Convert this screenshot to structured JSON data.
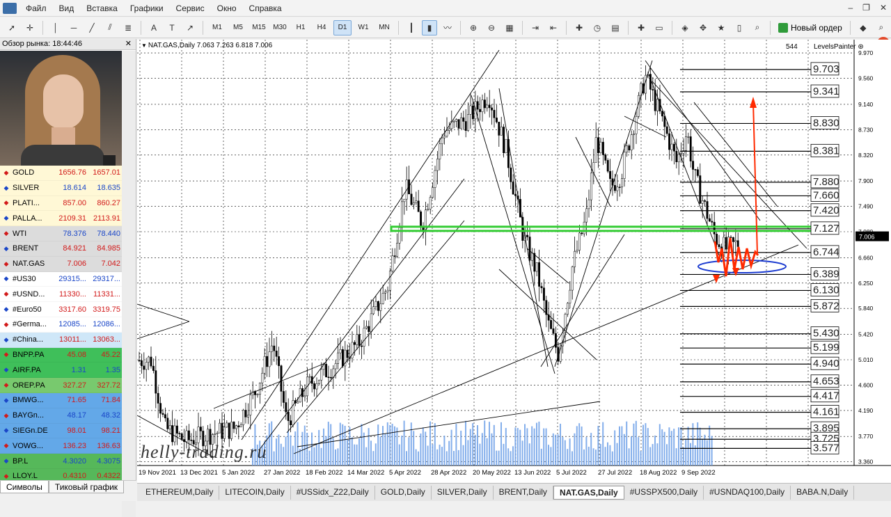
{
  "menu": [
    "Файл",
    "Вид",
    "Вставка",
    "Графики",
    "Сервис",
    "Окно",
    "Справка"
  ],
  "toolbar": {
    "timeframes": [
      "M1",
      "M5",
      "M15",
      "M30",
      "H1",
      "H4",
      "D1",
      "W1",
      "MN"
    ],
    "active_timeframe": "D1",
    "new_order_label": "Новый ордер",
    "notification_count": "1"
  },
  "market_watch": {
    "title": "Обзор рынка: 18:44:46",
    "rows": [
      {
        "symbol": "GOLD",
        "bid": "1656.76",
        "ask": "1657.01",
        "dir": "up",
        "style": "yl"
      },
      {
        "symbol": "SILVER",
        "bid": "18.614",
        "ask": "18.635",
        "dir": "up",
        "style": "yl"
      },
      {
        "symbol": "PLATI...",
        "bid": "857.00",
        "ask": "860.27",
        "dir": "up",
        "style": "yl"
      },
      {
        "symbol": "PALLA...",
        "bid": "2109.31",
        "ask": "2113.91",
        "dir": "up",
        "style": "yl"
      },
      {
        "symbol": "WTI",
        "bid": "78.376",
        "ask": "78.440",
        "dir": "up",
        "style": "gr"
      },
      {
        "symbol": "BRENT",
        "bid": "84.921",
        "ask": "84.985",
        "dir": "up",
        "style": "gr"
      },
      {
        "symbol": "NAT.GAS",
        "bid": "7.006",
        "ask": "7.042",
        "dir": "up",
        "style": "gr"
      },
      {
        "symbol": "#US30",
        "bid": "29315...",
        "ask": "29317...",
        "dir": "up",
        "style": "wh"
      },
      {
        "symbol": "#USND...",
        "bid": "11330...",
        "ask": "11331...",
        "dir": "up",
        "style": "wh"
      },
      {
        "symbol": "#Euro50",
        "bid": "3317.60",
        "ask": "3319.75",
        "dir": "up",
        "style": "wh"
      },
      {
        "symbol": "#Germa...",
        "bid": "12085...",
        "ask": "12086...",
        "dir": "up",
        "style": "wh"
      },
      {
        "symbol": "#China...",
        "bid": "13011...",
        "ask": "13063...",
        "dir": "up",
        "style": "bl"
      },
      {
        "symbol": "BNPP.PA",
        "bid": "45.08",
        "ask": "45.22",
        "dir": "up",
        "style": "gn"
      },
      {
        "symbol": "AIRF.PA",
        "bid": "1.31",
        "ask": "1.35",
        "dir": "up",
        "style": "gn"
      },
      {
        "symbol": "OREP.PA",
        "bid": "327.27",
        "ask": "327.72",
        "dir": "up",
        "style": "gn2"
      },
      {
        "symbol": "BMWG...",
        "bid": "71.65",
        "ask": "71.84",
        "dir": "up",
        "style": "bu"
      },
      {
        "symbol": "BAYGn...",
        "bid": "48.17",
        "ask": "48.32",
        "dir": "up",
        "style": "bu"
      },
      {
        "symbol": "SIEGn.DE",
        "bid": "98.01",
        "ask": "98.21",
        "dir": "up",
        "style": "bu"
      },
      {
        "symbol": "VOWG...",
        "bid": "136.23",
        "ask": "136.63",
        "dir": "up",
        "style": "bu"
      },
      {
        "symbol": "BP.L",
        "bid": "4.3020",
        "ask": "4.3075",
        "dir": "up",
        "style": "gn3"
      },
      {
        "symbol": "LLOY.L",
        "bid": "0.4310",
        "ask": "0.4322",
        "dir": "up",
        "style": "gn3"
      }
    ],
    "tabs": [
      "Символы",
      "Тиковый график"
    ]
  },
  "chart": {
    "header": "NAT.GAS,Daily  7.063 7.263 6.818 7.006",
    "bar_count": "544",
    "indicator": "LevelsPainter",
    "watermark": "helly-trading.ru",
    "current_price": "7.006",
    "price_axis": [
      "9.970",
      "9.560",
      "9.140",
      "8.730",
      "8.320",
      "7.900",
      "7.490",
      "7.080",
      "6.660",
      "6.250",
      "5.840",
      "5.420",
      "5.010",
      "4.600",
      "4.190",
      "3.770",
      "3.360"
    ],
    "levels": [
      "9.703",
      "9.341",
      "8.830",
      "8.381",
      "7.880",
      "7.660",
      "7.420",
      "7.127",
      "6.744",
      "6.389",
      "6.130",
      "5.872",
      "5.430",
      "5.199",
      "4.940",
      "4.653",
      "4.417",
      "4.161",
      "3.895",
      "3.725",
      "3.577"
    ],
    "time_axis": [
      "19 Nov 2021",
      "13 Dec 2021",
      "5 Jan 2022",
      "27 Jan 2022",
      "18 Feb 2022",
      "14 Mar 2022",
      "5 Apr 2022",
      "28 Apr 2022",
      "20 May 2022",
      "13 Jun 2022",
      "5 Jul 2022",
      "27 Jul 2022",
      "18 Aug 2022",
      "9 Sep 2022"
    ]
  },
  "bottom_tabs": [
    "ETHEREUM,Daily",
    "LITECOIN,Daily",
    "#USSidx_Z22,Daily",
    "GOLD,Daily",
    "SILVER,Daily",
    "BRENT,Daily",
    "NAT.GAS,Daily",
    "#USSPX500,Daily",
    "#USNDAQ100,Daily",
    "BABA.N,Daily"
  ],
  "active_bottom_tab": "NAT.GAS,Daily",
  "colors": {
    "green_level": "#33cc33",
    "annotation_red": "#ff2a00",
    "ellipse_blue": "#1a3ad0"
  }
}
